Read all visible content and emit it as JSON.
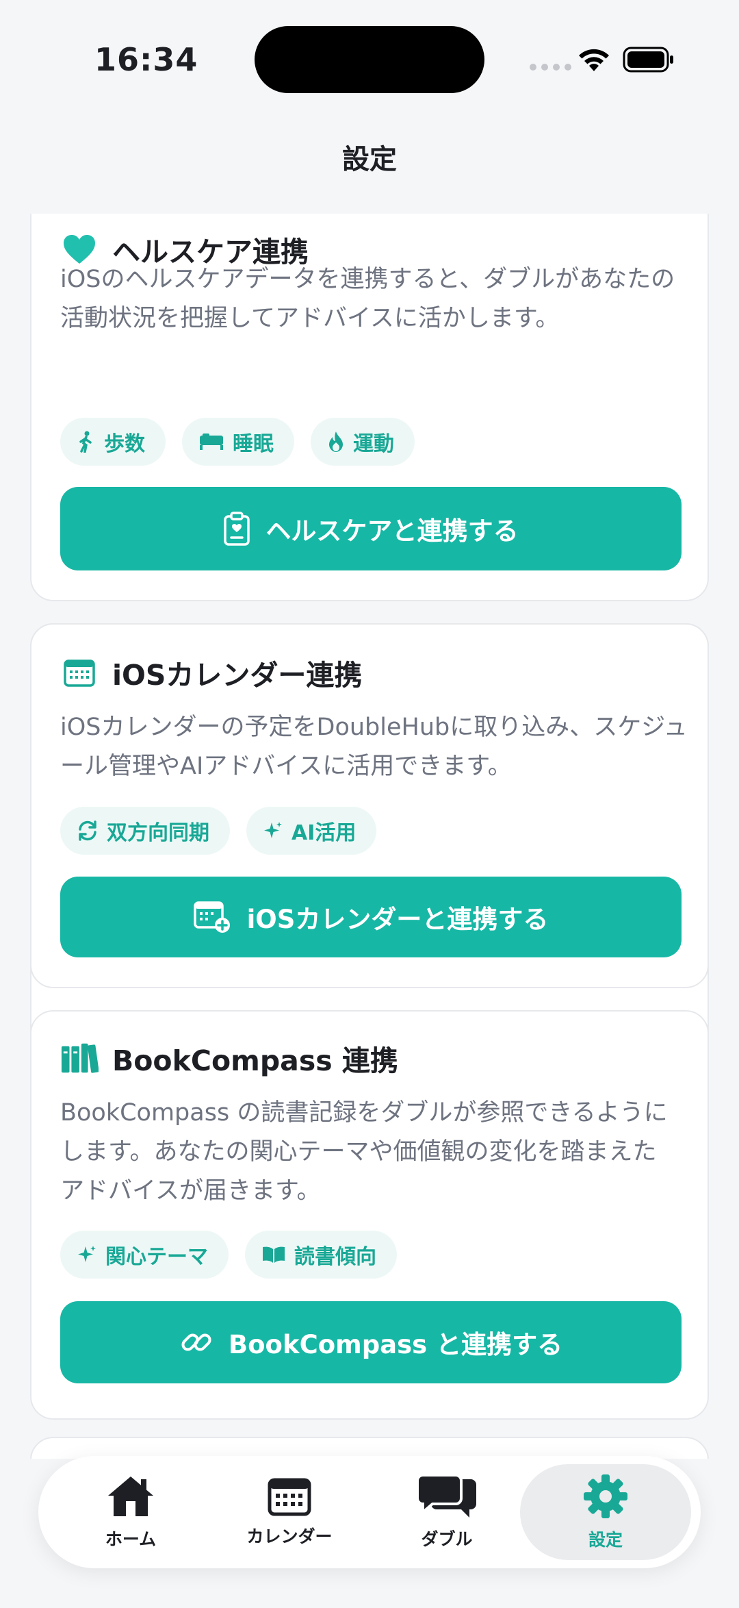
{
  "status_bar": {
    "time": "16:34"
  },
  "header": {
    "title": "設定"
  },
  "cards": {
    "health": {
      "title": "ヘルスケア連携",
      "description": "iOSのヘルスケアデータを連携すると、ダブルがあなたの活動状況を把握してアドバイスに活かします。",
      "chips": [
        "歩数",
        "睡眠",
        "運動"
      ],
      "button": "ヘルスケアと連携する"
    },
    "calendar": {
      "title": "iOSカレンダー連携",
      "description": "iOSカレンダーの予定をDoubleHubに取り込み、スケジュール管理やAIアドバイスに活用できます。",
      "chips": [
        "双方向同期",
        "AI活用"
      ],
      "button": "iOSカレンダーと連携する"
    },
    "bookcompass": {
      "title": "BookCompass 連携",
      "description": "BookCompass の読書記録をダブルが参照できるようにします。あなたの関心テーマや価値観の変化を踏まえたアドバイスが届きます。",
      "chips": [
        "関心テーマ",
        "読書傾向"
      ],
      "button": "BookCompass と連携する"
    }
  },
  "tabbar": {
    "items": [
      {
        "label": "ホーム",
        "icon": "home-icon"
      },
      {
        "label": "カレンダー",
        "icon": "calendar-icon"
      },
      {
        "label": "ダブル",
        "icon": "chat-bubbles-icon"
      },
      {
        "label": "設定",
        "icon": "gear-icon",
        "active": true
      }
    ]
  },
  "colors": {
    "accent": "#17b7a5",
    "chip_bg": "#edf8f6",
    "background": "#f5f6f8"
  }
}
